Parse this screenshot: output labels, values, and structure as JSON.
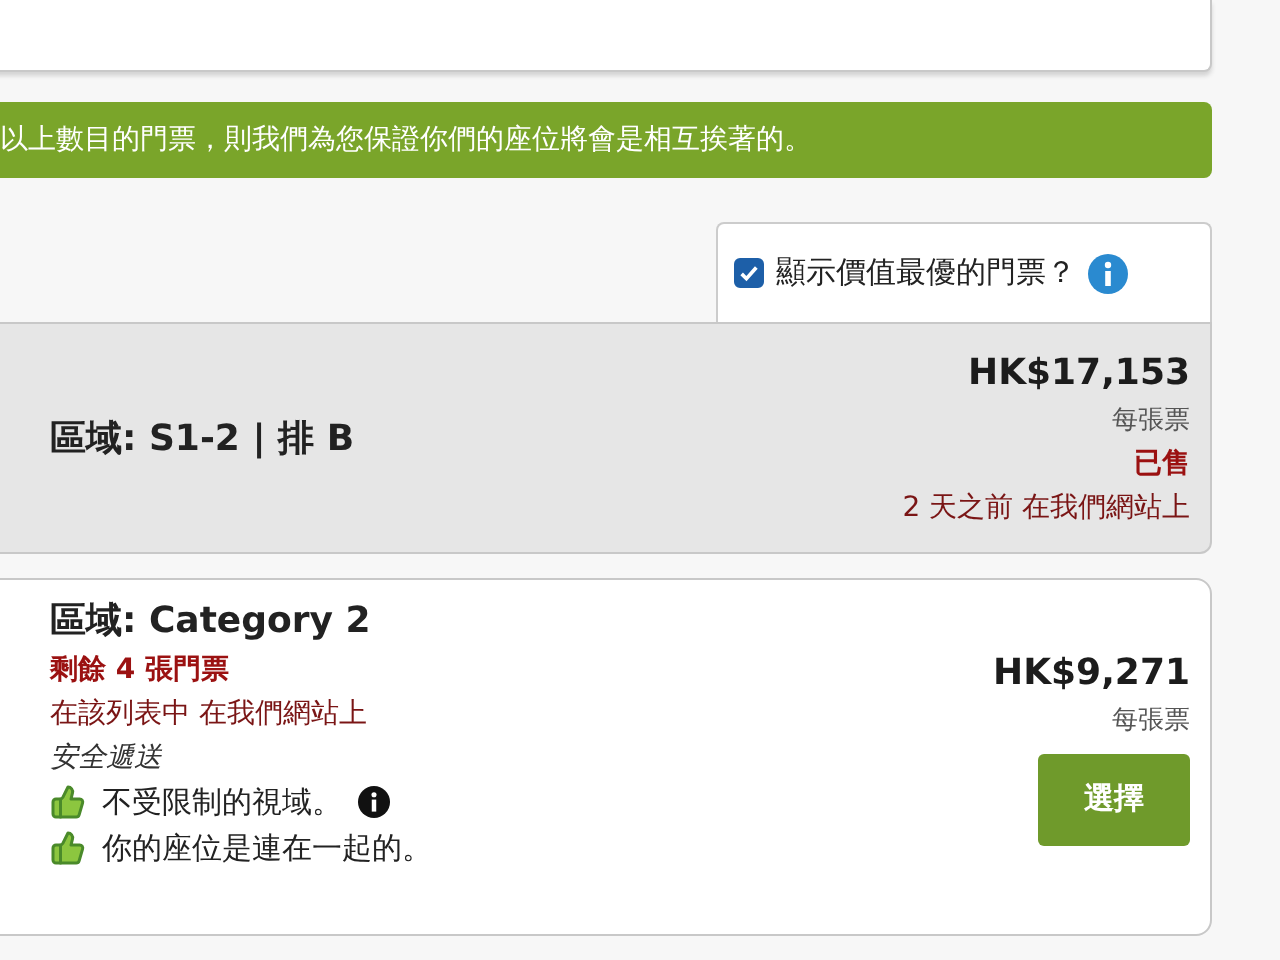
{
  "banner": {
    "text": "以上數目的門票，則我們為您保證你們的座位將會是相互挨著的。"
  },
  "best_value_toggle": {
    "label": "顯示價值最優的門票？",
    "checked": true
  },
  "listings": [
    {
      "kind": "sold",
      "section": "區域: S1-2 | 排 B",
      "price": "HK$17,153",
      "per_ticket": "每張票",
      "status": "已售",
      "sold_when": "2 天之前 在我們網站上"
    },
    {
      "kind": "available",
      "section": "區域: Category 2",
      "remaining": "剩餘 4 張門票",
      "listed": "在該列表中 在我們網站上",
      "delivery": "安全遞送",
      "features": [
        {
          "text": "不受限制的視域。",
          "info": true
        },
        {
          "text": "你的座位是連在一起的。",
          "info": false
        }
      ],
      "price": "HK$9,271",
      "per_ticket": "每張票",
      "button": "選擇"
    }
  ]
}
